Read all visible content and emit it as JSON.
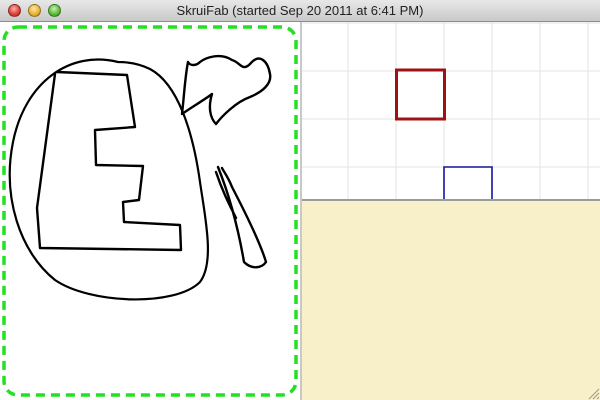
{
  "window": {
    "title": "SkruiFab (started Sep 20 2011 at 6:41 PM)"
  },
  "colors": {
    "selection_dash": "#22e022",
    "ink": "#000000",
    "red_square": "#a01212",
    "blue_square": "#16169a",
    "grid_line": "#e3e3e3",
    "tan_background": "#f8f0c8"
  },
  "icons": {
    "close": "close-button",
    "minimize": "minimize-button",
    "zoom": "zoom-button",
    "resize": "resize-grip-icon"
  }
}
